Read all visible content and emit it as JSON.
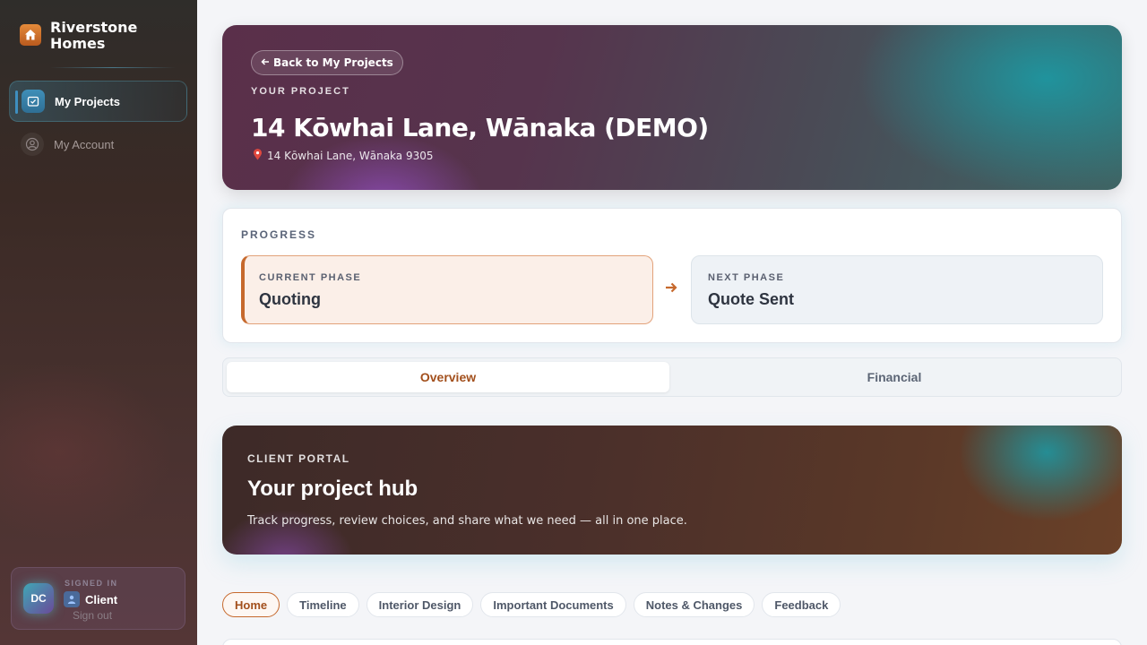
{
  "app": {
    "brand": "Riverstone Homes"
  },
  "sidebar": {
    "items": [
      {
        "label": "My Projects",
        "icon": "folder-check-icon",
        "active": true
      },
      {
        "label": "My Account",
        "icon": "user-circle-icon",
        "active": false
      }
    ],
    "user": {
      "initials": "DC",
      "signed_in_label": "SIGNED IN",
      "role": "Client",
      "sign_out": "Sign out"
    }
  },
  "hero": {
    "back_label": "Back to My Projects",
    "eyebrow": "YOUR PROJECT",
    "title": "14 Kōwhai Lane, Wānaka (DEMO)",
    "address": "14 Kōwhai Lane, Wānaka 9305"
  },
  "progress": {
    "heading": "PROGRESS",
    "current": {
      "label": "CURRENT PHASE",
      "value": "Quoting"
    },
    "next": {
      "label": "NEXT PHASE",
      "value": "Quote Sent"
    }
  },
  "tabs": [
    {
      "label": "Overview",
      "active": true
    },
    {
      "label": "Financial",
      "active": false
    }
  ],
  "portal": {
    "eyebrow": "CLIENT PORTAL",
    "title": "Your project hub",
    "description": "Track progress, review choices, and share what we need — all in one place."
  },
  "sections": [
    {
      "label": "Home",
      "active": true
    },
    {
      "label": "Timeline",
      "active": false
    },
    {
      "label": "Interior Design",
      "active": false
    },
    {
      "label": "Important Documents",
      "active": false
    },
    {
      "label": "Notes & Changes",
      "active": false
    },
    {
      "label": "Feedback",
      "active": false
    }
  ],
  "colors": {
    "accent": "#c6692d",
    "accent_text": "#a24f1c",
    "sidebar_active": "#3e8fc0"
  }
}
